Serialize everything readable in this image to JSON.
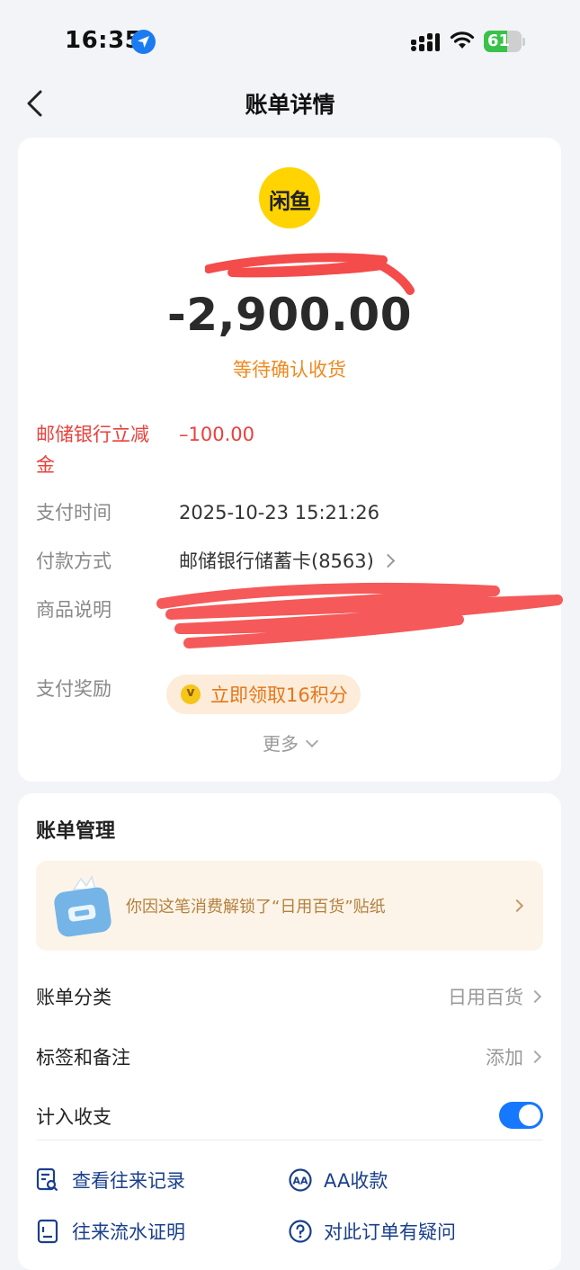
{
  "status_bar": {
    "time": "16:35",
    "battery": "61"
  },
  "nav": {
    "title": "账单详情"
  },
  "bill": {
    "merchant_logo_text": "闲鱼",
    "amount": "-2,900.00",
    "status": "等待确认收货",
    "rows": {
      "discount_label": "邮储银行立减金",
      "discount_value": "–100.00",
      "pay_time_label": "支付时间",
      "pay_time_value": "2025-10-23 15:21:26",
      "pay_method_label": "付款方式",
      "pay_method_value": "邮储银行储蓄卡(8563)",
      "product_label": "商品说明",
      "reward_label": "支付奖励",
      "reward_value": "立即领取16积分"
    },
    "more": "更多"
  },
  "manage": {
    "title": "账单管理",
    "banner_text": "你因这笔消费解锁了“日用百货”贴纸",
    "category_label": "账单分类",
    "category_value": "日用百货",
    "tags_label": "标签和备注",
    "tags_value": "添加",
    "include_label": "计入收支",
    "include_enabled": true,
    "actions": {
      "history": "查看往来记录",
      "aa": "AA收款",
      "proof": "往来流水证明",
      "question": "对此订单有疑问"
    }
  },
  "colors": {
    "accent_blue": "#1677ff",
    "orange": "#ef8a1f",
    "red": "#e8413c",
    "logo_yellow": "#ffd400"
  }
}
